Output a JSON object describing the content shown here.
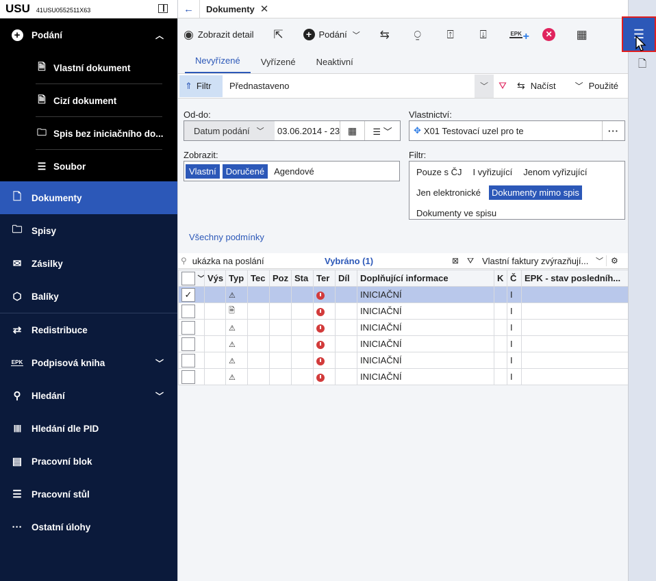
{
  "app": {
    "brand": "USU",
    "code": "41USU0552511X63"
  },
  "sidebar": {
    "podani": {
      "label": "Podání",
      "subitems": [
        {
          "label": "Vlastní dokument",
          "icon": "document-add-icon"
        },
        {
          "label": "Cizí dokument",
          "icon": "document-in-icon"
        },
        {
          "label": "Spis bez iniciačního do...",
          "icon": "folder-icon"
        },
        {
          "label": "Soubor",
          "icon": "file-icon"
        }
      ]
    },
    "items": [
      {
        "label": "Dokumenty",
        "icon": "document-icon",
        "active": true
      },
      {
        "label": "Spisy",
        "icon": "folder-icon"
      },
      {
        "label": "Zásilky",
        "icon": "mail-icon"
      },
      {
        "label": "Balíky",
        "icon": "box-icon"
      },
      {
        "label": "Redistribuce",
        "icon": "redistribute-icon"
      },
      {
        "label": "Podpisová kniha",
        "icon": "epk-icon"
      },
      {
        "label": "Hledání",
        "icon": "search-icon"
      },
      {
        "label": "Hledání dle PID",
        "icon": "barcode-icon"
      },
      {
        "label": "Pracovní blok",
        "icon": "calendar-icon"
      },
      {
        "label": "Pracovní stůl",
        "icon": "list-icon"
      },
      {
        "label": "Ostatní úlohy",
        "icon": "more-icon"
      }
    ]
  },
  "tab": {
    "title": "Dokumenty"
  },
  "toolbar": {
    "detail_label": "Zobrazit detail",
    "podani_label": "Podání",
    "epk": "EPK"
  },
  "subtabs": [
    "Nevyřízené",
    "Vyřízené",
    "Neaktivní"
  ],
  "filterbar": {
    "filter_label": "Filtr",
    "preset": "Přednastaveno",
    "load_label": "Načíst",
    "used_label": "Použité"
  },
  "filters": {
    "oddo_label": "Od-do:",
    "oddo_select": "Datum podání",
    "oddo_date": "03.06.2014 - 23",
    "vlastnictvi_label": "Vlastnictví:",
    "vlastnictvi_value": "X01 Testovací uzel pro te",
    "zobrazit_label": "Zobrazit:",
    "zobrazit_chips": [
      {
        "label": "Vlastní",
        "on": true
      },
      {
        "label": "Doručené",
        "on": true
      },
      {
        "label": "Agendové",
        "on": false
      }
    ],
    "filtr_label": "Filtr:",
    "filtr_chips": [
      {
        "label": "Pouze s ČJ",
        "on": false
      },
      {
        "label": "I vyřizující",
        "on": false
      },
      {
        "label": "Jenom vyřizující",
        "on": false
      },
      {
        "label": "Jen elektronické",
        "on": false
      },
      {
        "label": "Dokumenty mimo spis",
        "on": true
      },
      {
        "label": "Dokumenty ve spisu",
        "on": false
      }
    ],
    "all_conditions": "Všechny podmínky"
  },
  "grid": {
    "search_value": "ukázka na poslání",
    "selected": "Vybráno (1)",
    "preset": "Vlastní faktury zvýrazňují...",
    "columns": [
      "Výs",
      "Typ",
      "Tec",
      "Poz",
      "Sta",
      "Ter",
      "Díl",
      "Doplňující informace",
      "K",
      "Č",
      "EPK - stav posledníh..."
    ],
    "rows": [
      {
        "checked": "✓",
        "info": "INICIAČNÍ",
        "c": "I",
        "selected": true
      },
      {
        "checked": "",
        "info": "INICIAČNÍ",
        "c": "I"
      },
      {
        "checked": "",
        "info": "INICIAČNÍ",
        "c": "I"
      },
      {
        "checked": "",
        "info": "INICIAČNÍ",
        "c": "I"
      },
      {
        "checked": "",
        "info": "INICIAČNÍ",
        "c": "I"
      },
      {
        "checked": "",
        "info": "INICIAČNÍ",
        "c": "I"
      }
    ]
  },
  "colors": {
    "sidebar_bg": "#0b1a3b",
    "accent": "#2c58b8",
    "highlight_border": "#e01e1e"
  }
}
